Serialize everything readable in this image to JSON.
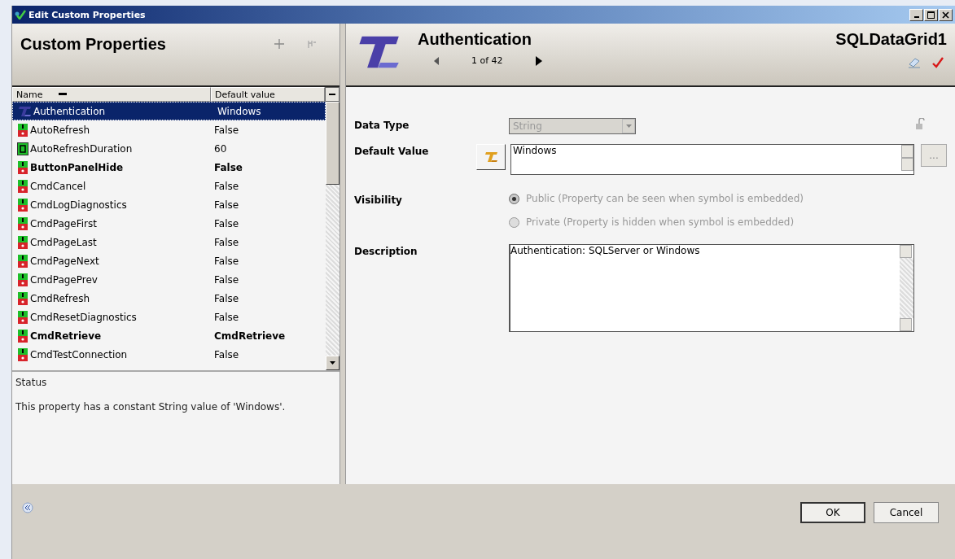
{
  "window": {
    "title": "Edit Custom Properties"
  },
  "list_panel": {
    "title": "Custom Properties",
    "columns": [
      {
        "label": "Name",
        "sorted": true
      },
      {
        "label": "Default value",
        "sorted": false
      }
    ],
    "rows": [
      {
        "kind": "text",
        "name": "Authentication",
        "value": "Windows",
        "bold": false,
        "selected": true
      },
      {
        "kind": "boolean",
        "name": "AutoRefresh",
        "value": "False",
        "bold": false,
        "selected": false
      },
      {
        "kind": "number",
        "name": "AutoRefreshDuration",
        "value": "60",
        "bold": false,
        "selected": false
      },
      {
        "kind": "boolean",
        "name": "ButtonPanelHide",
        "value": "False",
        "bold": true,
        "selected": false
      },
      {
        "kind": "boolean",
        "name": "CmdCancel",
        "value": "False",
        "bold": false,
        "selected": false
      },
      {
        "kind": "boolean",
        "name": "CmdLogDiagnostics",
        "value": "False",
        "bold": false,
        "selected": false
      },
      {
        "kind": "boolean",
        "name": "CmdPageFirst",
        "value": "False",
        "bold": false,
        "selected": false
      },
      {
        "kind": "boolean",
        "name": "CmdPageLast",
        "value": "False",
        "bold": false,
        "selected": false
      },
      {
        "kind": "boolean",
        "name": "CmdPageNext",
        "value": "False",
        "bold": false,
        "selected": false
      },
      {
        "kind": "boolean",
        "name": "CmdPagePrev",
        "value": "False",
        "bold": false,
        "selected": false
      },
      {
        "kind": "boolean",
        "name": "CmdRefresh",
        "value": "False",
        "bold": false,
        "selected": false
      },
      {
        "kind": "boolean",
        "name": "CmdResetDiagnostics",
        "value": "False",
        "bold": false,
        "selected": false
      },
      {
        "kind": "boolean",
        "name": "CmdRetrieve",
        "value": "CmdRetrieve",
        "bold": true,
        "selected": false
      },
      {
        "kind": "boolean",
        "name": "CmdTestConnection",
        "value": "False",
        "bold": false,
        "selected": false
      }
    ],
    "status": {
      "label": "Status",
      "text": "This property has a constant String value of 'Windows'."
    }
  },
  "detail_panel": {
    "title": "Authentication",
    "counter": "1 of 42",
    "object": "SQLDataGrid1",
    "data_type": {
      "label": "Data Type",
      "value": "String",
      "disabled": true
    },
    "default_value": {
      "label": "Default Value",
      "value": "Windows",
      "browse": "..."
    },
    "visibility": {
      "label": "Visibility",
      "options": [
        {
          "label": "Public (Property can be seen when symbol is embedded)",
          "selected": true,
          "disabled": true
        },
        {
          "label": "Private (Property is hidden when symbol is embedded)",
          "selected": false,
          "disabled": true
        }
      ]
    },
    "description": {
      "label": "Description",
      "value": "Authentication: SQLServer or Windows"
    }
  },
  "buttons": [
    {
      "label": "OK"
    },
    {
      "label": "Cancel"
    }
  ]
}
